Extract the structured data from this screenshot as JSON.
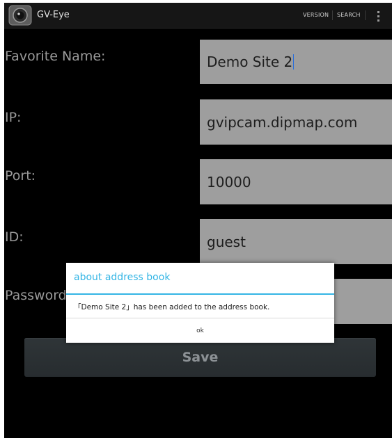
{
  "app": {
    "name": "GV-Eye",
    "actions": [
      "VERSION",
      "SEARCH"
    ]
  },
  "form": {
    "favorite_name": {
      "label": "Favorite Name:",
      "value": "Demo Site 2"
    },
    "ip": {
      "label": "IP:",
      "value": "gvipcam.dipmap.com"
    },
    "port": {
      "label": "Port:",
      "value": "10000"
    },
    "id": {
      "label": "ID:",
      "value": "guest"
    },
    "password": {
      "label": "Password:",
      "value": ""
    },
    "save_label": "Save"
  },
  "dialog": {
    "title": "about address book",
    "message": "「Demo Site 2」has been added to the address book.",
    "ok_label": "ok"
  },
  "colors": {
    "accent": "#33b5e5",
    "field_bg": "#9e9e9e",
    "screen_bg": "#000000"
  },
  "icons": {
    "app": "gv-eye-camera-icon",
    "overflow": "overflow-menu-icon"
  }
}
